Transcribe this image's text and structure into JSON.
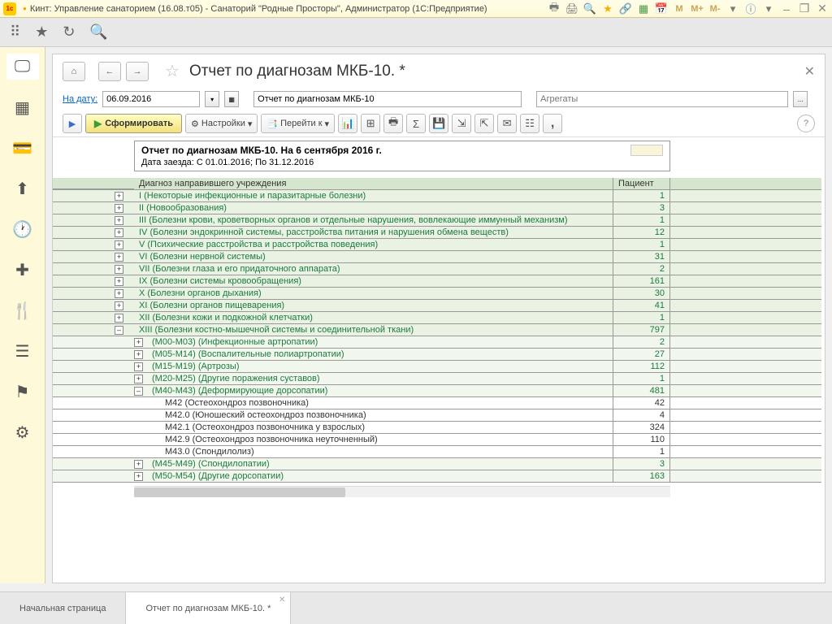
{
  "titlebar": {
    "title": "Кинт: Управление санаторием (16.08.т05) - Санаторий \"Родные Просторы\", Администратор  (1С:Предприятие)",
    "mem": [
      "M",
      "M+",
      "M-"
    ]
  },
  "page": {
    "title": "Отчет по диагнозам МКБ-10. *"
  },
  "filter": {
    "date_label": "На дату:",
    "date_value": "06.09.2016",
    "report_name": "Отчет по диагнозам МКБ-10",
    "agg_placeholder": "Агрегаты",
    "dots": "..."
  },
  "buttons": {
    "form": "Сформировать",
    "settings": "Настройки",
    "goto": "Перейти к"
  },
  "report_header": {
    "line1": "Отчет по диагнозам МКБ-10. На 6 сентября 2016 г.",
    "line2": "Дата заезда: С 01.01.2016; По 31.12.2016"
  },
  "columns": {
    "diag": "Диагноз направившего учреждения",
    "pat": "Пациент"
  },
  "rows": [
    {
      "lvl": 0,
      "ex": "+",
      "diag": "I (Некоторые инфекционные и паразитарные болезни)",
      "pat": "1"
    },
    {
      "lvl": 0,
      "ex": "+",
      "diag": "II (Новообразования)",
      "pat": "3"
    },
    {
      "lvl": 0,
      "ex": "+",
      "diag": "III (Болезни крови, кроветворных органов и отдельные нарушения, вовлекающие иммунный механизм)",
      "pat": "1"
    },
    {
      "lvl": 0,
      "ex": "+",
      "diag": "IV (Болезни эндокринной системы, расстройства питания и нарушения обмена веществ)",
      "pat": "12"
    },
    {
      "lvl": 0,
      "ex": "+",
      "diag": "V (Психические расстройства и расстройства поведения)",
      "pat": "1"
    },
    {
      "lvl": 0,
      "ex": "+",
      "diag": "VI (Болезни нервной системы)",
      "pat": "31"
    },
    {
      "lvl": 0,
      "ex": "+",
      "diag": "VII (Болезни глаза и его придаточного аппарата)",
      "pat": "2"
    },
    {
      "lvl": 0,
      "ex": "+",
      "diag": "IX (Болезни системы кровообращения)",
      "pat": "161"
    },
    {
      "lvl": 0,
      "ex": "+",
      "diag": "X (Болезни органов дыхания)",
      "pat": "30"
    },
    {
      "lvl": 0,
      "ex": "+",
      "diag": "XI (Болезни органов пищеварения)",
      "pat": "41"
    },
    {
      "lvl": 0,
      "ex": "+",
      "diag": "XII (Болезни кожи и подкожной клетчатки)",
      "pat": "1"
    },
    {
      "lvl": 0,
      "ex": "–",
      "diag": "XIII (Болезни костно-мышечной системы и соединительной ткани)",
      "pat": "797"
    },
    {
      "lvl": 1,
      "ex": "+",
      "diag": "(M00-M03) (Инфекционные артропатии)",
      "pat": "2"
    },
    {
      "lvl": 1,
      "ex": "+",
      "diag": "(M05-M14) (Воспалительные полиартропатии)",
      "pat": "27"
    },
    {
      "lvl": 1,
      "ex": "+",
      "diag": "(M15-M19) (Артрозы)",
      "pat": "112"
    },
    {
      "lvl": 1,
      "ex": "+",
      "diag": "(M20-M25) (Другие поражения суставов)",
      "pat": "1"
    },
    {
      "lvl": 1,
      "ex": "–",
      "diag": "(M40-M43) (Деформирующие дорсопатии)",
      "pat": "481"
    },
    {
      "lvl": 2,
      "ex": "",
      "diag": "M42 (Остеохондроз позвоночника)",
      "pat": "42"
    },
    {
      "lvl": 2,
      "ex": "",
      "diag": "M42.0 (Юношеский остеохондроз позвоночника)",
      "pat": "4"
    },
    {
      "lvl": 2,
      "ex": "",
      "diag": "M42.1 (Остеохондроз позвоночника у взрослых)",
      "pat": "324"
    },
    {
      "lvl": 2,
      "ex": "",
      "diag": "M42.9 (Остеохондроз позвоночника неуточненный)",
      "pat": "110"
    },
    {
      "lvl": 2,
      "ex": "",
      "diag": "M43.0 (Спондилолиз)",
      "pat": "1"
    },
    {
      "lvl": 1,
      "ex": "+",
      "diag": "(M45-M49) (Спондилопатии)",
      "pat": "3"
    },
    {
      "lvl": 1,
      "ex": "+",
      "diag": "(M50-M54) (Другие дорсопатии)",
      "pat": "163"
    }
  ],
  "tabs": {
    "home": "Начальная страница",
    "report": "Отчет по диагнозам МКБ-10. *"
  }
}
